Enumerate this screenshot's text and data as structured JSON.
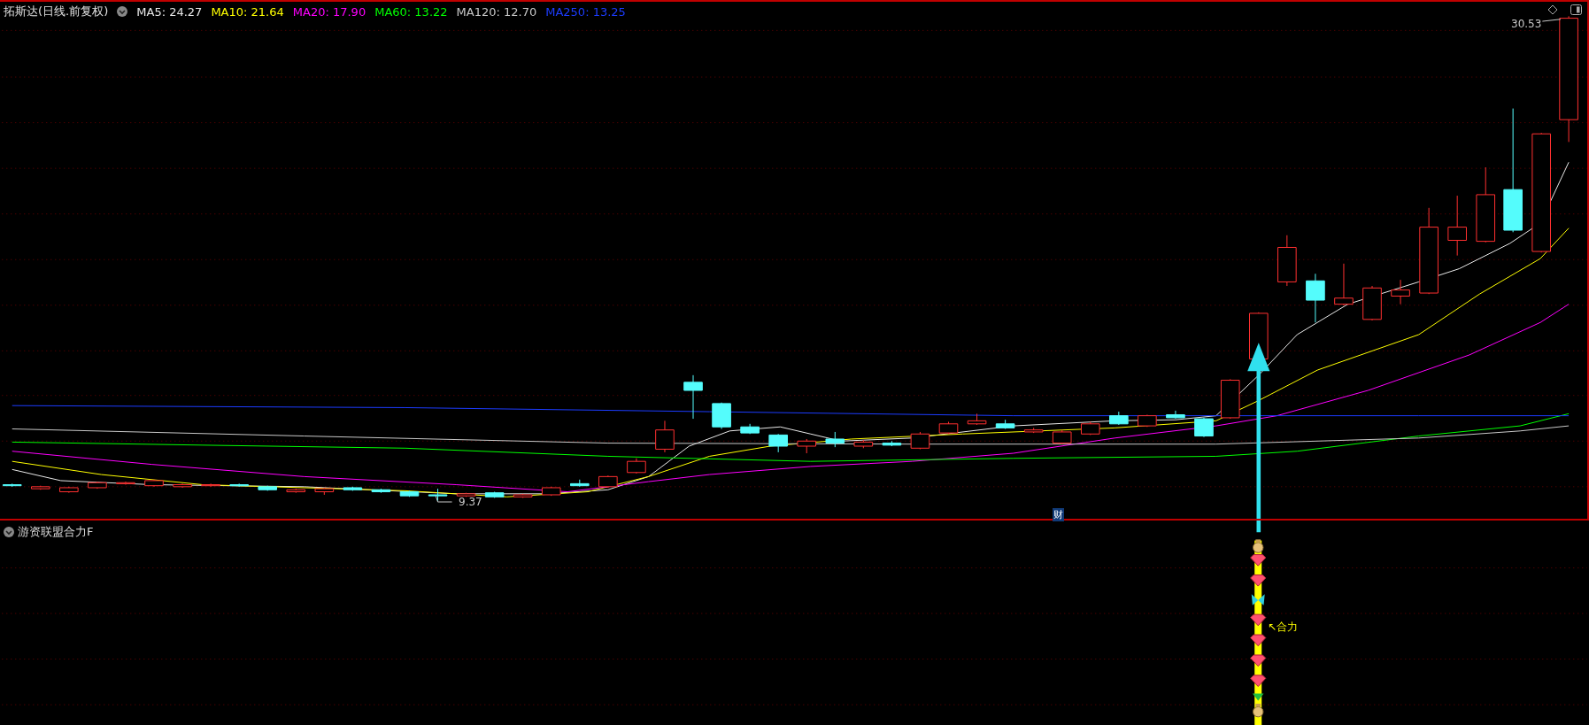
{
  "main_chart": {
    "title": "拓斯达(日线.前复权)",
    "legend": [
      {
        "label": "MA5: 24.27",
        "color": "#e8e8e8"
      },
      {
        "label": "MA10: 21.64",
        "color": "#ffff00"
      },
      {
        "label": "MA20: 17.90",
        "color": "#ff00ff"
      },
      {
        "label": "MA60: 13.22",
        "color": "#00ff00"
      },
      {
        "label": "MA120: 12.70",
        "color": "#c8c8c8"
      },
      {
        "label": "MA250: 13.25",
        "color": "#1c3cff"
      }
    ],
    "high_label": "30.53",
    "low_label": "9.37",
    "event_badge": "财"
  },
  "indicator": {
    "title": "游资联盟合力F",
    "signal_label": "↖合力"
  }
}
